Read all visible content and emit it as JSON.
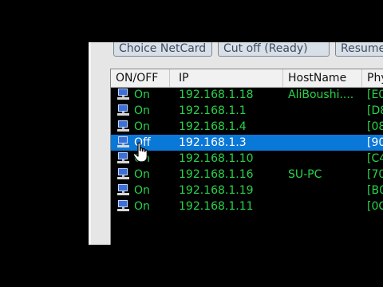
{
  "toolbar": {
    "choice_netcard": "Choice NetCard",
    "cut_off": "Cut off (Ready)",
    "resume": "Resume"
  },
  "columns": [
    "ON/OFF",
    "IP",
    "HostName",
    "Phy"
  ],
  "rows": [
    {
      "status": "On",
      "ip": "192.168.1.18",
      "host": "AliBoushi....",
      "phy": "[E0"
    },
    {
      "status": "On",
      "ip": "192.168.1.1",
      "host": "",
      "phy": "[D8"
    },
    {
      "status": "On",
      "ip": "192.168.1.4",
      "host": "",
      "phy": "[08"
    },
    {
      "status": "Off",
      "ip": "192.168.1.3",
      "host": "",
      "phy": "[90",
      "selected": true
    },
    {
      "status": "On",
      "ip": "192.168.1.10",
      "host": "",
      "phy": "[C4"
    },
    {
      "status": "On",
      "ip": "192.168.1.16",
      "host": "SU-PC",
      "phy": "[70"
    },
    {
      "status": "On",
      "ip": "192.168.1.19",
      "host": "",
      "phy": "[B0"
    },
    {
      "status": "On",
      "ip": "192.168.1.11",
      "host": "",
      "phy": "[0C"
    }
  ],
  "colors": {
    "row_text": "#29d34a",
    "selection": "#0a78d7",
    "background": "#000000"
  }
}
